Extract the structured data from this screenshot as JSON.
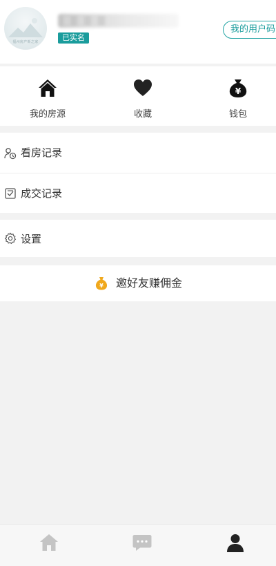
{
  "header": {
    "avatar_caption": "福州房产新之家",
    "verified_badge": "已实名",
    "user_code_button": "我的用户码"
  },
  "quick_actions": [
    {
      "label": "我的房源",
      "icon": "house-icon"
    },
    {
      "label": "收藏",
      "icon": "heart-icon"
    },
    {
      "label": "钱包",
      "icon": "money-bag-icon"
    }
  ],
  "menu": {
    "viewing_records": "看房记录",
    "deal_records": "成交记录",
    "settings": "设置"
  },
  "invite": {
    "label": "邀好友赚佣金"
  },
  "tabbar": [
    {
      "icon": "home-tab-icon",
      "active": false
    },
    {
      "icon": "message-tab-icon",
      "active": false
    },
    {
      "icon": "profile-tab-icon",
      "active": true
    }
  ],
  "colors": {
    "accent": "#1a9c9c",
    "invite_icon": "#f0a81c"
  }
}
